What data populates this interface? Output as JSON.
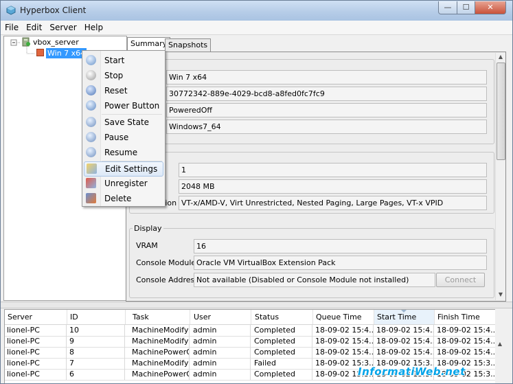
{
  "window": {
    "title": "Hyperbox Client",
    "minimize_glyph": "—",
    "maximize_glyph": "☐",
    "close_glyph": "✕"
  },
  "menu": [
    "File",
    "Edit",
    "Server",
    "Help"
  ],
  "tree": {
    "server": "vbox_server",
    "machine": "Win 7 x64"
  },
  "tabs": [
    "Summary",
    "Snapshots"
  ],
  "general": {
    "name": "Win 7 x64",
    "uuid": "30772342-889e-4029-bcd8-a8fed0fc7fc9",
    "state": "PoweredOff",
    "os_type": "Windows7_64"
  },
  "system": {
    "cpu_count": "1",
    "memory": "2048 MB",
    "acceleration_label_fragment": "tion",
    "acceleration": "VT-x/AMD-V, Virt Unrestricted, Nested Paging, Large Pages, VT-x VPID"
  },
  "display": {
    "legend": "Display",
    "vram_label": "VRAM",
    "vram": "16",
    "console_module_label": "Console Module",
    "console_module": "Oracle VM VirtualBox Extension Pack",
    "console_address_label": "Console Address",
    "console_address": "Not available (Disabled or Console Module not installed)",
    "connect_button": "Connect"
  },
  "context_menu": {
    "items": [
      "Start",
      "Stop",
      "Reset",
      "Power Button",
      "Save State",
      "Pause",
      "Resume",
      "Edit Settings",
      "Unregister",
      "Delete"
    ],
    "highlighted": "Edit Settings"
  },
  "tasks": {
    "columns": [
      "Server",
      "ID",
      "Task",
      "User",
      "Status",
      "Queue Time",
      "Start Time",
      "Finish Time"
    ],
    "sorted_column": "Start Time",
    "rows": [
      [
        "lionel-PC",
        "10",
        "MachineModify",
        "admin",
        "Completed",
        "18-09-02 15:4...",
        "18-09-02 15:4...",
        "18-09-02 15:4..."
      ],
      [
        "lionel-PC",
        "9",
        "MachineModify",
        "admin",
        "Completed",
        "18-09-02 15:4...",
        "18-09-02 15:4...",
        "18-09-02 15:4..."
      ],
      [
        "lionel-PC",
        "8",
        "MachinePowerOff",
        "admin",
        "Completed",
        "18-09-02 15:4...",
        "18-09-02 15:4...",
        "18-09-02 15:4..."
      ],
      [
        "lionel-PC",
        "7",
        "MachineModify",
        "admin",
        "Failed",
        "18-09-02 15:3...",
        "18-09-02 15:3...",
        "18-09-02 15:3..."
      ],
      [
        "lionel-PC",
        "6",
        "MachinePowerOn",
        "admin",
        "Completed",
        "18-09-02 15:3...",
        "18-09-02 15:3...",
        "18-09-02 15:3..."
      ]
    ]
  },
  "watermark": "InformatiWeb.net",
  "colors": {
    "selection": "#3399ff",
    "title_bar": "#b7cde8",
    "close_button": "#c9523b",
    "watermark": "#00a3e8"
  }
}
